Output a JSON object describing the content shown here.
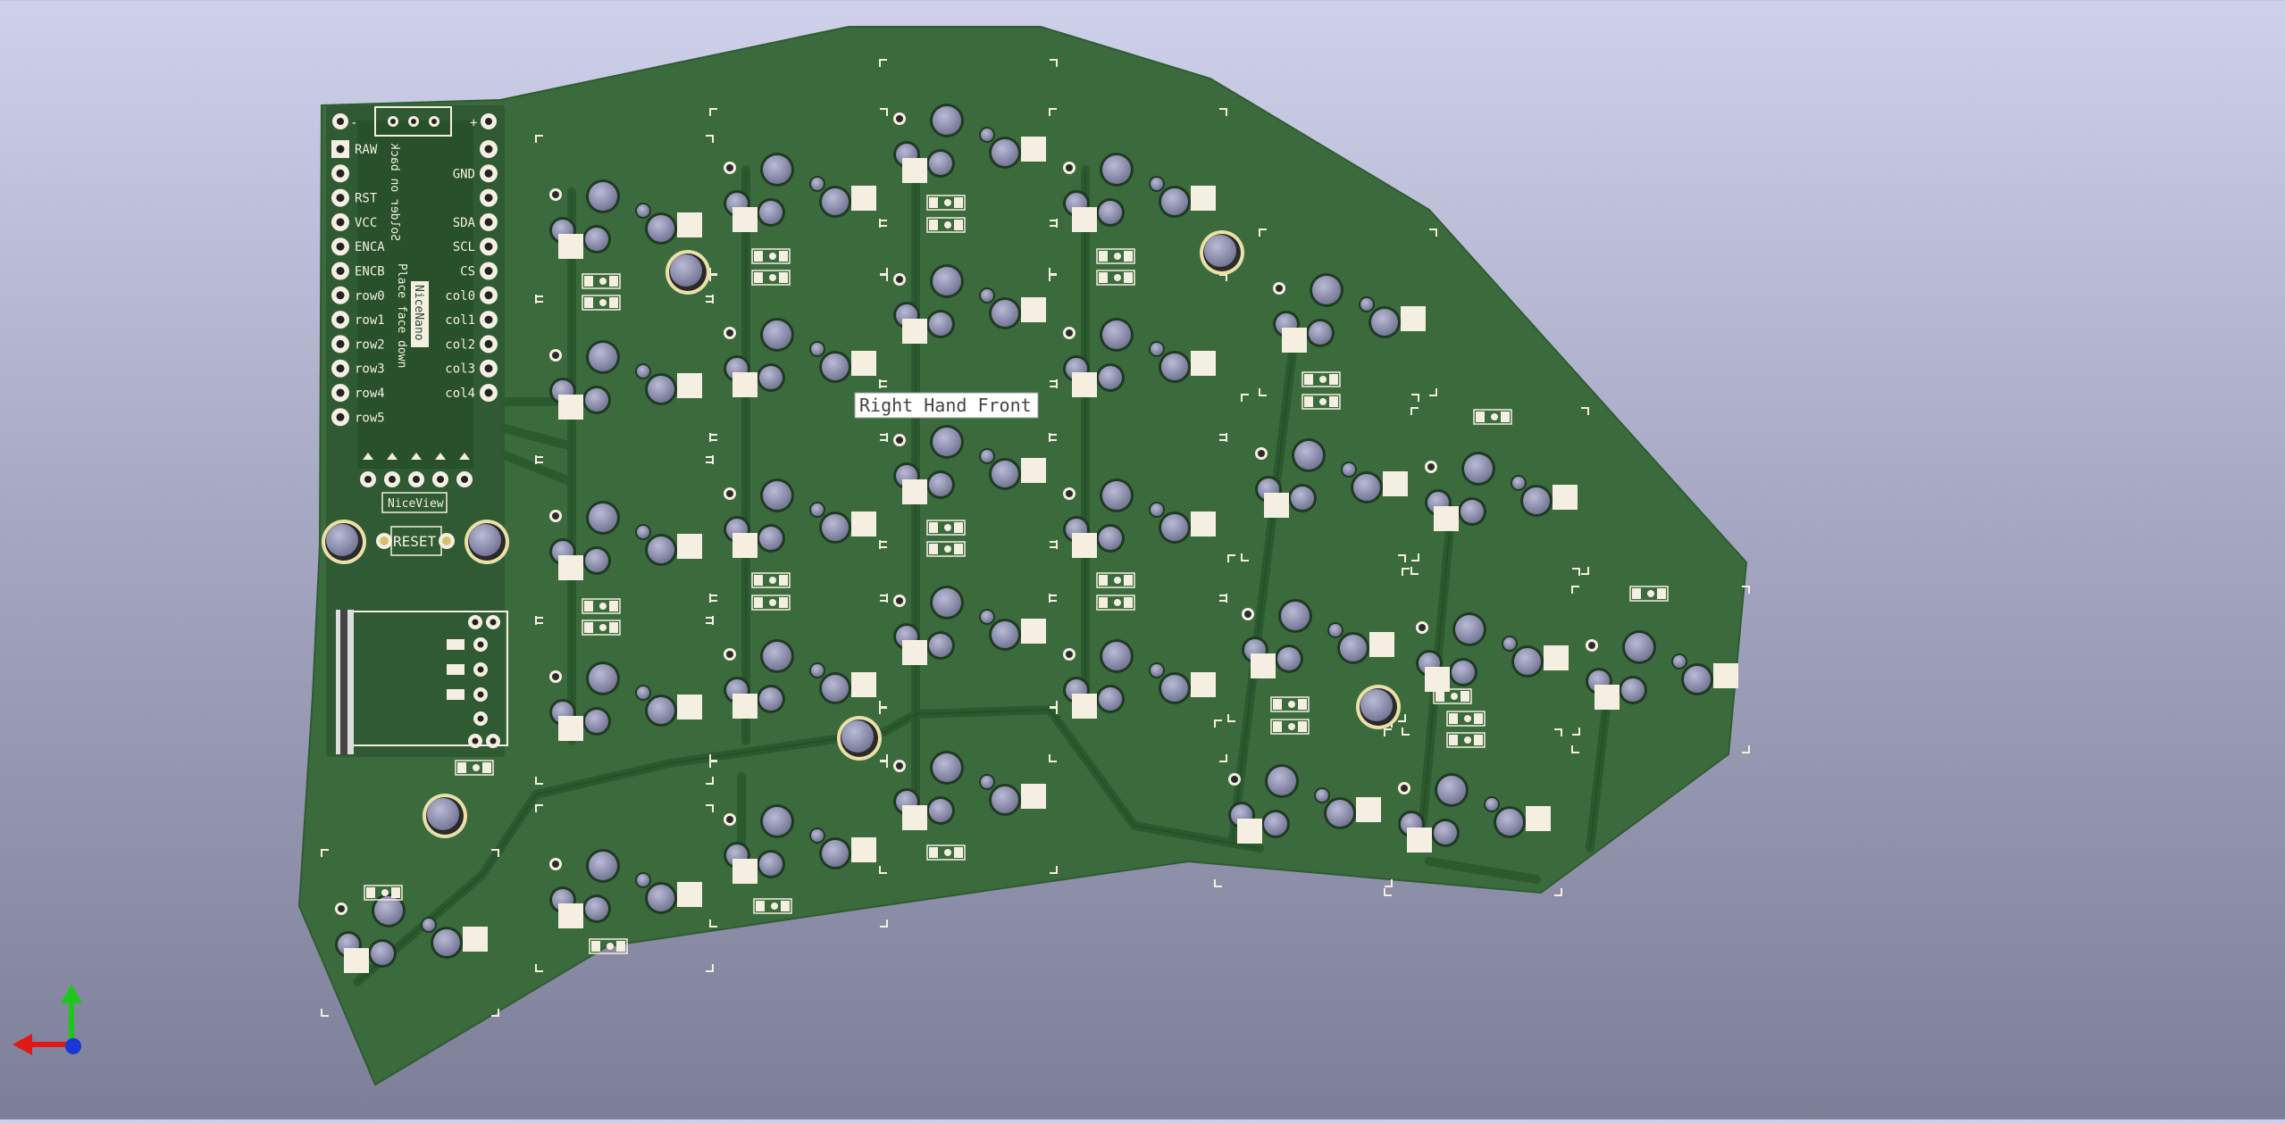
{
  "window": {
    "background_top": "#cfd1ea",
    "background_bottom": "#7d7f98"
  },
  "board": {
    "name": "Right Hand Front",
    "color": "#3b6b3d",
    "trace_color": "#2d5a30",
    "copper_color": "#f4efe0",
    "mount_hole_color": "#eae0a8"
  },
  "mcu": {
    "chip_name": "NiceNano",
    "note_line1": "Place face down",
    "note_line2": "Solder on back",
    "left_pins": [
      "RAW",
      "",
      "RST",
      "VCC",
      "ENCA",
      "ENCB",
      "row0",
      "row1",
      "row2",
      "row3",
      "row4",
      "row5"
    ],
    "right_pins": [
      "",
      "GND",
      "",
      "SDA",
      "SCL",
      "CS",
      "col0",
      "col1",
      "col2",
      "col3",
      "col4"
    ],
    "top_left": "-",
    "top_right": "+"
  },
  "display": {
    "label": "NiceView"
  },
  "reset": {
    "label": "RESET"
  },
  "axes": {
    "x_icon": "arrow-left-red",
    "y_icon": "arrow-up-green",
    "z_icon": "dot-blue"
  }
}
